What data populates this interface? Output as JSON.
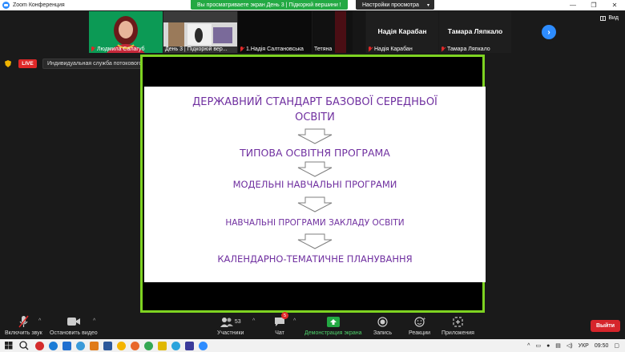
{
  "window": {
    "title": "Zoom Конференция",
    "controls": [
      "—",
      "❐",
      "✕"
    ]
  },
  "share_banner": "Вы просматриваете экран День 3 | Підкорюй вершини !",
  "view_options": {
    "label": "Настройки просмотра"
  },
  "view_button": {
    "label": "Вид"
  },
  "participants_strip": [
    {
      "name": "Людмила Салагуб",
      "muted": true
    },
    {
      "name": "День 3 | Підкорюй вер...",
      "muted": false
    },
    {
      "name": "1.Надія Салтановська",
      "muted": true
    },
    {
      "name": "Тетяна",
      "muted": false
    },
    {
      "name": "Надія Карабан",
      "muted": true,
      "display_name": "Надія Карабан"
    },
    {
      "name": "Тамара Ляпкало",
      "muted": true,
      "display_name": "Тамара Ляпкало"
    }
  ],
  "live": {
    "badge": "LIVE",
    "service": "Индивидуальная служба потокового вещания"
  },
  "slide": {
    "lines": [
      "ДЕРЖАВНИЙ СТАНДАРТ БАЗОВОЇ СЕРЕДНЬОЇ",
      "ОСВІТИ",
      "ТИПОВА ОСВІТНЯ ПРОГРАМА",
      "МОДЕЛЬНІ НАВЧАЛЬНІ ПРОГРАМИ",
      "НАВЧАЛЬНІ ПРОГРАМИ ЗАКЛАДУ ОСВІТИ",
      "КАЛЕНДАРНО-ТЕМАТИЧНЕ ПЛАНУВАННЯ"
    ],
    "text_color": "#7030a0"
  },
  "toolbar": {
    "unmute": "Включить звук",
    "stop_video": "Остановить видео",
    "participants": "Участники",
    "participants_count": "53",
    "chat": "Чат",
    "chat_badge": "5",
    "share_screen": "Демонстрация экрана",
    "record": "Запись",
    "reactions": "Реакции",
    "apps": "Приложения",
    "leave": "Выйти"
  },
  "taskbar": {
    "language": "УКР",
    "time": "09:50"
  },
  "colors": {
    "accent": "#2D8CFF",
    "share_green": "#23a943",
    "frame_green": "#7ed321",
    "live_red": "#e02828",
    "leave_red": "#d6252b"
  }
}
